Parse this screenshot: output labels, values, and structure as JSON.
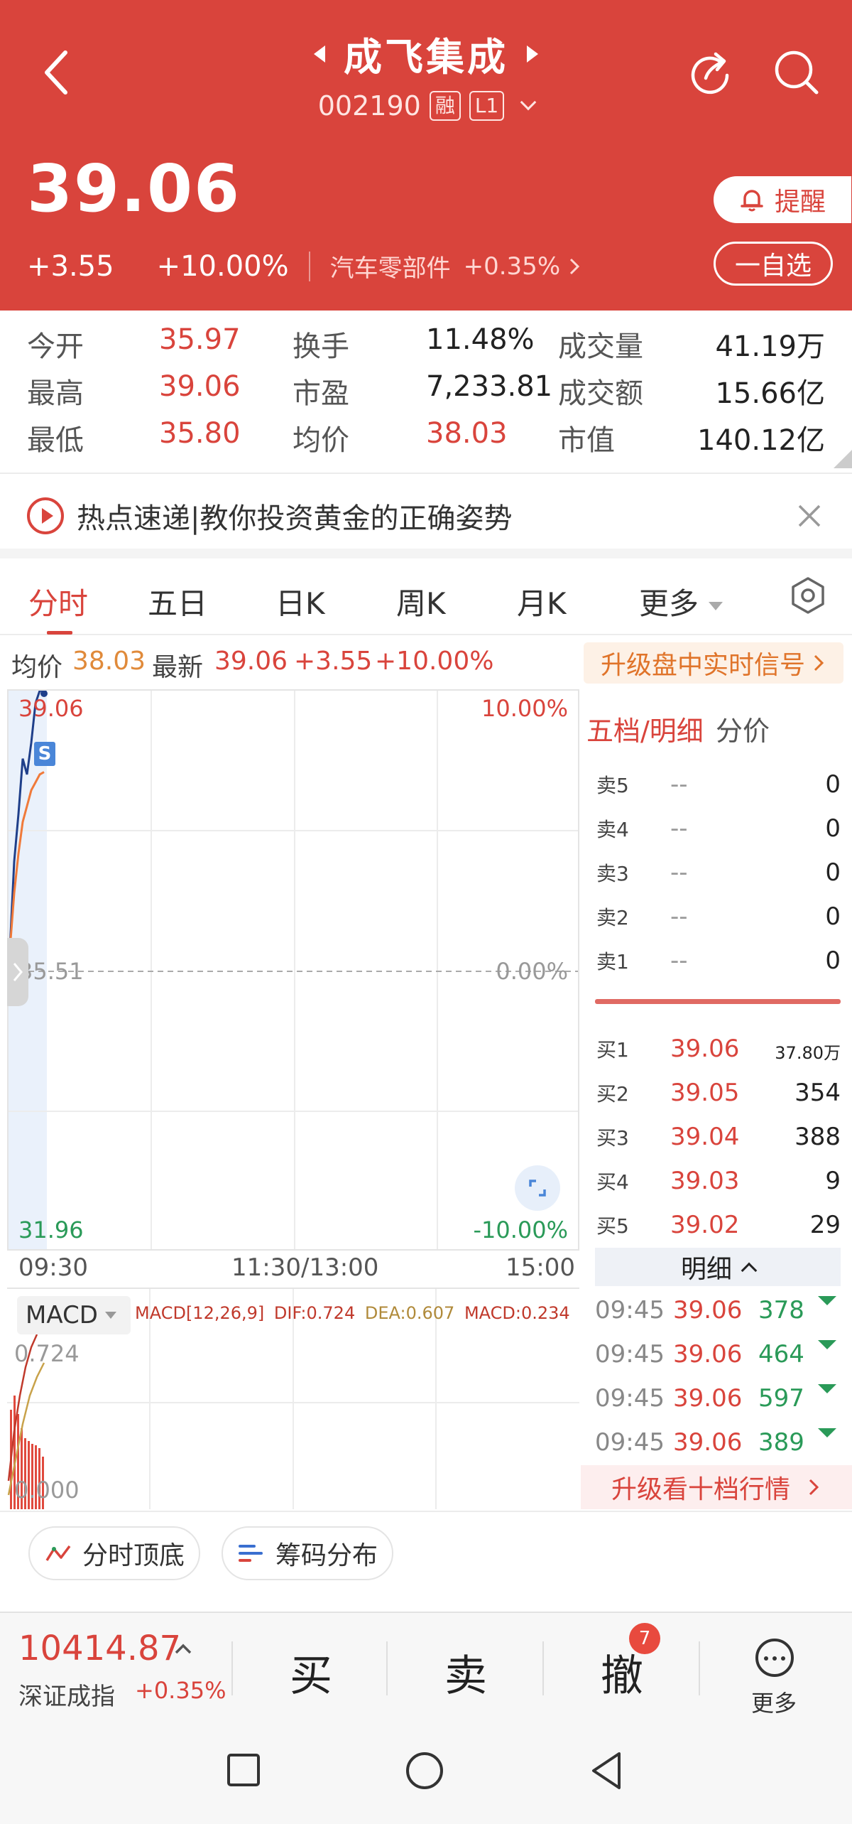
{
  "header": {
    "stock_name": "成飞集成",
    "stock_code": "002190",
    "margin_tag": "融",
    "level_tag": "L1",
    "price": "39.06",
    "change": "+3.55",
    "change_pct": "+10.00%",
    "sector": "汽车零部件",
    "sector_pct": "+0.35%",
    "alert_label": "提醒",
    "watch_label": "一自选"
  },
  "stats": {
    "rows": [
      {
        "l1": "今开",
        "v1": "35.97",
        "l2": "换手",
        "v2": "11.48%",
        "l3": "成交量",
        "v3": "41.19万"
      },
      {
        "l1": "最高",
        "v1": "39.06",
        "l2": "市盈",
        "v2": "7,233.81",
        "l3": "成交额",
        "v3": "15.66亿"
      },
      {
        "l1": "最低",
        "v1": "35.80",
        "l2": "均价",
        "v2": "38.03",
        "l3": "市值",
        "v3": "140.12亿"
      }
    ]
  },
  "news": {
    "text": "热点速递|教你投资黄金的正确姿势"
  },
  "tabs": [
    "分时",
    "五日",
    "日K",
    "周K",
    "月K",
    "更多"
  ],
  "info": {
    "avg_label": "均价",
    "avg_value": "38.03",
    "latest_label": "最新",
    "latest_value": "39.06",
    "change": "+3.55",
    "change_pct": "+10.00%",
    "upgrade_signal": "升级盘中实时信号"
  },
  "chart_data": {
    "type": "line",
    "y_left_top": "39.06",
    "y_left_mid": "35.51",
    "y_left_bottom": "31.96",
    "y_right_top": "10.00%",
    "y_right_mid": "0.00%",
    "y_right_bottom": "-10.00%",
    "x_ticks": [
      "09:30",
      "11:30/13:00",
      "15:00"
    ],
    "ylim": [
      31.96,
      39.06
    ],
    "series": [
      {
        "name": "最新",
        "color": "#1f3f8a",
        "values": [
          35.8,
          36.9,
          37.5,
          38.2,
          38.0,
          38.4,
          38.9,
          39.06,
          39.06
        ]
      },
      {
        "name": "均价",
        "color": "#f07a3a",
        "values": [
          35.8,
          36.5,
          37.0,
          37.4,
          37.6,
          37.8,
          37.9,
          38.0,
          38.03
        ]
      }
    ],
    "marker": "S"
  },
  "macd": {
    "selector": "MACD",
    "legend_title": "MACD[12,26,9]",
    "dif": "DIF:0.724",
    "dea": "DEA:0.607",
    "macd": "MACD:0.234",
    "top_value": "0.724",
    "bottom_value": "0.000"
  },
  "order_book": {
    "title": "五档/明细",
    "subtitle": "分价",
    "sells": [
      {
        "label": "卖5",
        "price": "--",
        "vol": "0"
      },
      {
        "label": "卖4",
        "price": "--",
        "vol": "0"
      },
      {
        "label": "卖3",
        "price": "--",
        "vol": "0"
      },
      {
        "label": "卖2",
        "price": "--",
        "vol": "0"
      },
      {
        "label": "卖1",
        "price": "--",
        "vol": "0"
      }
    ],
    "buys": [
      {
        "label": "买1",
        "price": "39.06",
        "vol": "37.80万"
      },
      {
        "label": "买2",
        "price": "39.05",
        "vol": "354"
      },
      {
        "label": "买3",
        "price": "39.04",
        "vol": "388"
      },
      {
        "label": "买4",
        "price": "39.03",
        "vol": "9"
      },
      {
        "label": "买5",
        "price": "39.02",
        "vol": "29"
      }
    ],
    "detail_label": "明细",
    "ticks": [
      {
        "time": "09:45",
        "price": "39.06",
        "vol": "378"
      },
      {
        "time": "09:45",
        "price": "39.06",
        "vol": "464"
      },
      {
        "time": "09:45",
        "price": "39.06",
        "vol": "597"
      },
      {
        "time": "09:45",
        "price": "39.06",
        "vol": "389"
      }
    ],
    "upgrade10": "升级看十档行情"
  },
  "pills": {
    "top_bottom": "分时顶底",
    "chips": "筹码分布"
  },
  "trade_bar": {
    "index_value": "10414.87",
    "index_name": "深证成指",
    "index_pct": "+0.35%",
    "buy": "买",
    "sell": "卖",
    "cancel": "撤",
    "cancel_badge": "7",
    "more": "更多"
  },
  "colors": {
    "brand_red": "#d9443c",
    "down_green": "#2a9a58",
    "avg_orange": "#f07a3a",
    "price_line": "#1f3f8a"
  }
}
